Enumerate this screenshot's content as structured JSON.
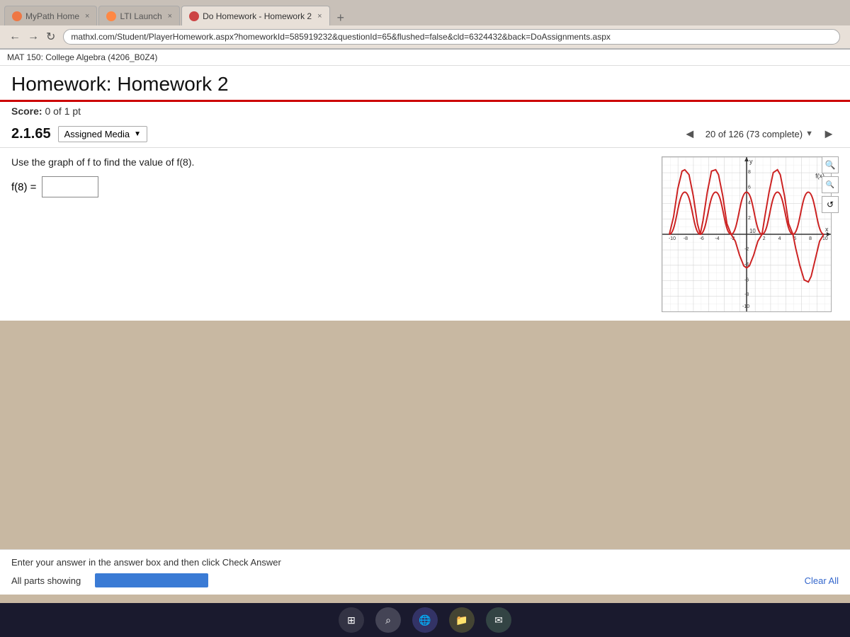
{
  "browser": {
    "tabs": [
      {
        "id": "mypath",
        "label": "MyPath Home",
        "active": false,
        "icon_color": "#e07050"
      },
      {
        "id": "lti",
        "label": "LTI Launch",
        "active": false,
        "icon_color": "#f08040"
      },
      {
        "id": "homework",
        "label": "Do Homework - Homework 2",
        "active": true,
        "icon_color": "#cc4444"
      }
    ],
    "address": "mathxl.com/Student/PlayerHomework.aspx?homeworkId=585919232&questionId=65&flushed=false&cld=6324432&back=DoAssignments.aspx"
  },
  "page_header": {
    "course": "MAT 150: College Algebra (4206_B0Z4)"
  },
  "homework": {
    "title": "Homework: Homework 2",
    "score_label": "Score:",
    "score_value": "0 of 1 pt",
    "question_num": "2.1.65",
    "assigned_media": "Assigned Media",
    "progress": "20 of 126 (73 complete)",
    "question_text": "Use the graph of f to find the value of f(8).",
    "answer_label": "f(8) =",
    "answer_placeholder": "",
    "bottom_instruction": "Enter your answer in the answer box and then click Check Answer",
    "all_parts_label": "All parts showing",
    "clear_all": "Clear All"
  },
  "icons": {
    "zoom_in": "🔍",
    "zoom_out": "🔍",
    "refresh": "↺",
    "back": "←",
    "forward": "→",
    "chevron_left": "◄",
    "chevron_right": "►",
    "chevron_down": "▼"
  }
}
